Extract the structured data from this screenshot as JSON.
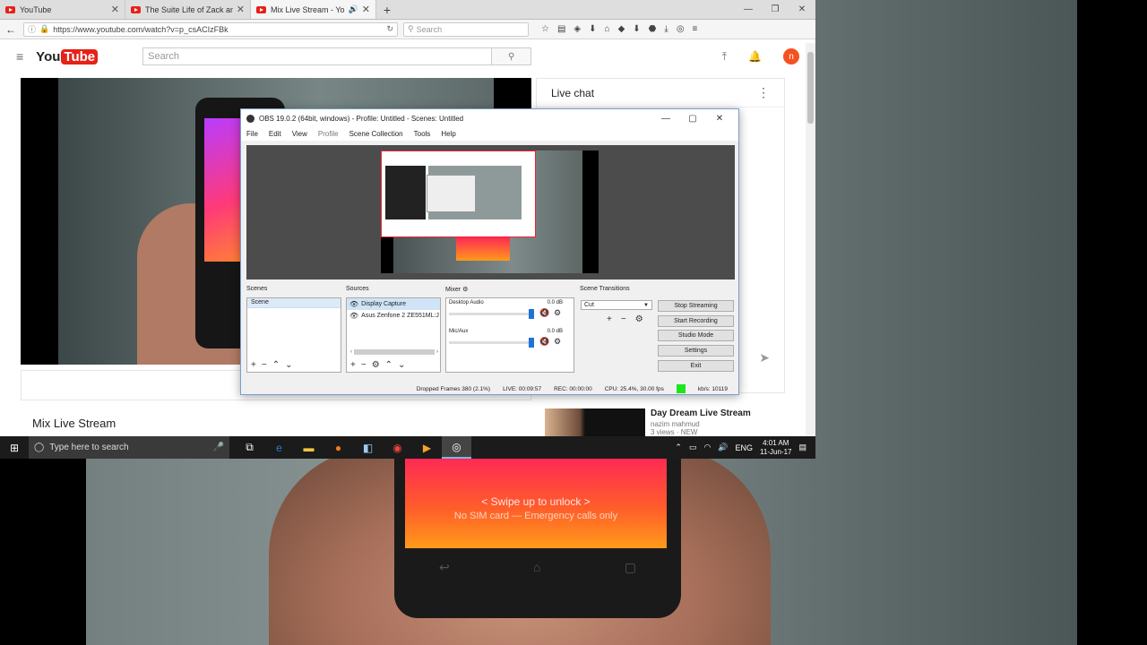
{
  "browser": {
    "tabs": [
      {
        "title": "YouTube",
        "icon": "youtube-favicon"
      },
      {
        "title": "The Suite Life of Zack and C",
        "icon": "youtube-favicon"
      },
      {
        "title": "Mix Live Stream - YouTu",
        "icon": "youtube-favicon",
        "active": true
      }
    ],
    "url": "https://www.youtube.com/watch?v=p_csACIzFBk",
    "search_placeholder": "Search"
  },
  "youtube": {
    "logo_you": "You",
    "logo_tube": "Tube",
    "search_placeholder": "Search",
    "avatar_letter": "n",
    "video_title": "Mix Live Stream",
    "live_chat_title": "Live chat",
    "suggestion": {
      "title": "Day Dream Live Stream",
      "author": "nazim mahmud",
      "views": "3 views · NEW"
    }
  },
  "obs": {
    "title": "OBS 19.0.2 (64bit, windows) - Profile: Untitled - Scenes: Untitled",
    "menu": {
      "file": "File",
      "edit": "Edit",
      "view": "View",
      "profile": "Profile",
      "scene_collection": "Scene Collection",
      "tools": "Tools",
      "help": "Help"
    },
    "labels": {
      "scenes": "Scenes",
      "sources": "Sources",
      "mixer": "Mixer",
      "scene_transitions": "Scene Transitions"
    },
    "scenes": [
      "Scene"
    ],
    "sources": [
      "Display Capture",
      "Asus Zenfone 2 ZE551ML:J"
    ],
    "mixer": [
      {
        "name": "Desktop Audio",
        "db": "0.0 dB"
      },
      {
        "name": "Mic/Aux",
        "db": "0.0 dB"
      }
    ],
    "transition": "Cut",
    "buttons": {
      "stop_streaming": "Stop Streaming",
      "start_recording": "Start Recording",
      "studio_mode": "Studio Mode",
      "settings": "Settings",
      "exit": "Exit"
    },
    "status": {
      "dropped": "Dropped Frames 380 (2.1%)",
      "live": "LIVE: 00:09:57",
      "rec": "REC: 00:00:00",
      "cpu": "CPU: 25.4%, 30.00 fps",
      "kbps": "kb/s: 10119"
    }
  },
  "background": {
    "swipe_text": "< Swipe up to unlock >",
    "sim_text": "No SIM card — Emergency calls only"
  },
  "taskbar": {
    "search_placeholder": "Type here to search",
    "lang": "ENG",
    "time": "4:01 AM",
    "date": "11-Jun-17"
  }
}
